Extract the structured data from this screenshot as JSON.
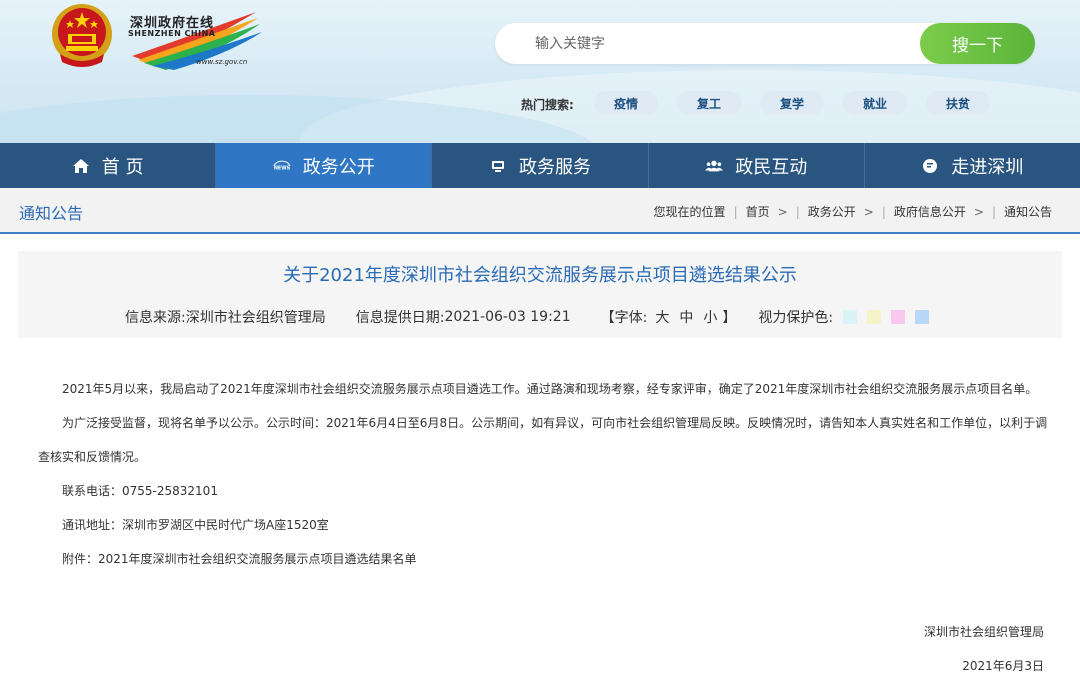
{
  "logo": {
    "cn": "深圳政府在线",
    "en": "SHENZHEN CHINA",
    "url": "www.sz.gov.cn"
  },
  "search": {
    "placeholder": "输入关键字",
    "button": "搜一下"
  },
  "hot": {
    "label": "热门搜索:",
    "tags": [
      "疫情",
      "复工",
      "复学",
      "就业",
      "扶贫"
    ]
  },
  "nav": {
    "items": [
      {
        "label": "首 页",
        "icon": "home-icon"
      },
      {
        "label": "政务公开",
        "icon": "news-icon"
      },
      {
        "label": "政务服务",
        "icon": "monitor-icon"
      },
      {
        "label": "政民互动",
        "icon": "users-icon"
      },
      {
        "label": "走进深圳",
        "icon": "chat-icon"
      }
    ],
    "active_index": 1
  },
  "breadcrumb": {
    "section_title": "通知公告",
    "you_are_here": "您现在的位置",
    "items": [
      "首页",
      "政务公开",
      "政府信息公开",
      "通知公告"
    ]
  },
  "article": {
    "title": "关于2021年度深圳市社会组织交流服务展示点项目遴选结果公示",
    "source_label": "信息来源:",
    "source": "深圳市社会组织管理局",
    "date_label": "信息提供日期:",
    "date": "2021-06-03 19:21",
    "font_label": "【字体:",
    "font_large": "大",
    "font_medium": "中",
    "font_small": "小",
    "font_close": "】",
    "eye_label": "视力保护色:",
    "eye_colors": [
      "#d9f3f6",
      "#f6f3c8",
      "#f8c8ee",
      "#b9d8f8"
    ],
    "paragraphs": [
      "2021年5月以来，我局启动了2021年度深圳市社会组织交流服务展示点项目遴选工作。通过路演和现场考察，经专家评审，确定了2021年度深圳市社会组织交流服务展示点项目名单。",
      "为广泛接受监督，现将名单予以公示。公示时间：2021年6月4日至6月8日。公示期间，如有异议，可向市社会组织管理局反映。反映情况时，请告知本人真实姓名和工作单位，以利于调查核实和反馈情况。"
    ],
    "phone": "联系电话：0755-25832101",
    "address": "通讯地址：深圳市罗湖区中民时代广场A座1520室",
    "attachment": "附件：2021年度深圳市社会组织交流服务展示点项目遴选结果名单",
    "signature": "深圳市社会组织管理局",
    "sign_date": "2021年6月3日"
  }
}
